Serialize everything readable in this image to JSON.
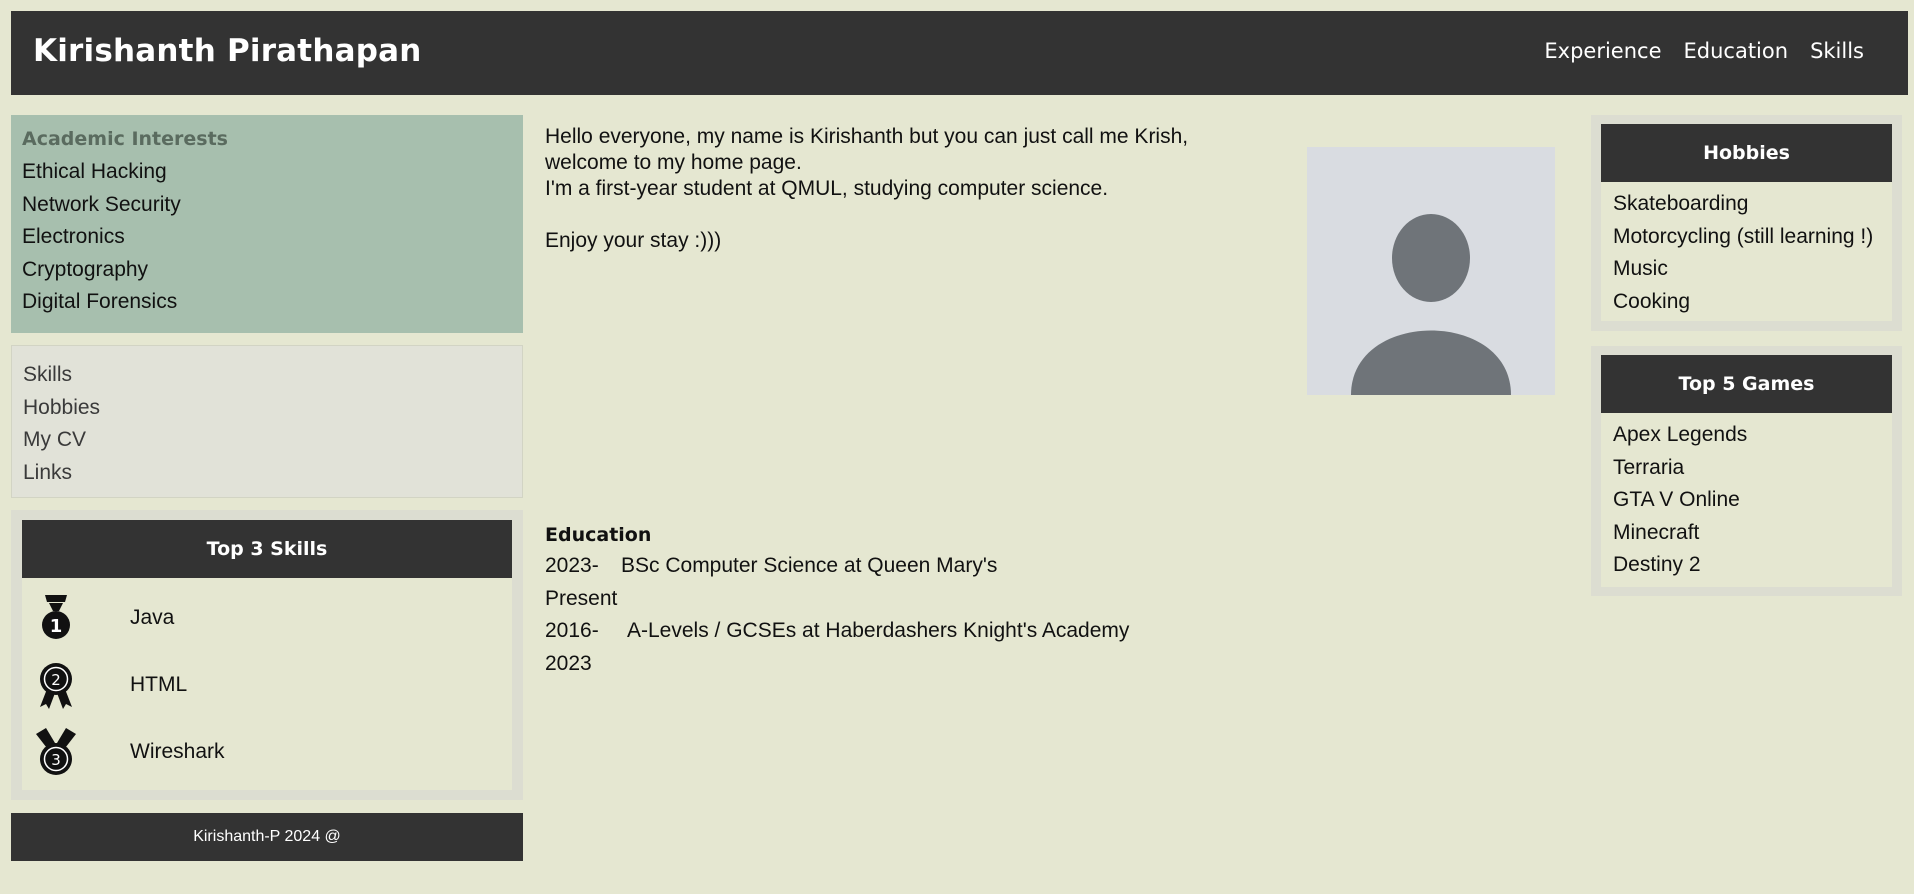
{
  "header": {
    "title": "Kirishanth Pirathapan",
    "nav": [
      "Experience",
      "Education",
      "Skills"
    ]
  },
  "interests": {
    "title": "Academic Interests",
    "items": [
      "Ethical Hacking",
      "Network Security",
      "Electronics",
      "Cryptography",
      "Digital Forensics"
    ]
  },
  "side_nav": {
    "items": [
      "Skills",
      "Hobbies",
      "My CV",
      "Links"
    ]
  },
  "top_skills": {
    "title": "Top 3 Skills",
    "items": [
      {
        "icon": "first-place-medal-icon",
        "name": "Java"
      },
      {
        "icon": "second-place-medal-icon",
        "name": "HTML"
      },
      {
        "icon": "third-place-medal-icon",
        "name": "Wireshark"
      }
    ]
  },
  "footer": {
    "text": "Kirishanth-P 2024 @"
  },
  "intro": {
    "line1": "Hello everyone, my name is Kirishanth but you can just call me Krish, welcome to my home page.",
    "line2": "I'm a first-year student at QMUL, studying computer science.",
    "line3": "Enjoy your stay :)))"
  },
  "avatar": {
    "icon": "user-avatar-icon"
  },
  "education": {
    "title": "Education",
    "entries": [
      {
        "date": "2023- Present",
        "text": "BSc Computer Science at Queen Mary's"
      },
      {
        "date": "2016- 2023",
        "text": "A-Levels / GCSEs at Haberdashers Knight's Academy"
      }
    ]
  },
  "hobbies": {
    "title": "Hobbies",
    "items": [
      "Skateboarding",
      "Motorcycling (still learning !)",
      "Music",
      "Cooking"
    ]
  },
  "games": {
    "title": "Top 5 Games",
    "items": [
      "Apex Legends",
      "Terraria",
      "GTA V Online",
      "Minecraft",
      "Destiny 2"
    ]
  }
}
